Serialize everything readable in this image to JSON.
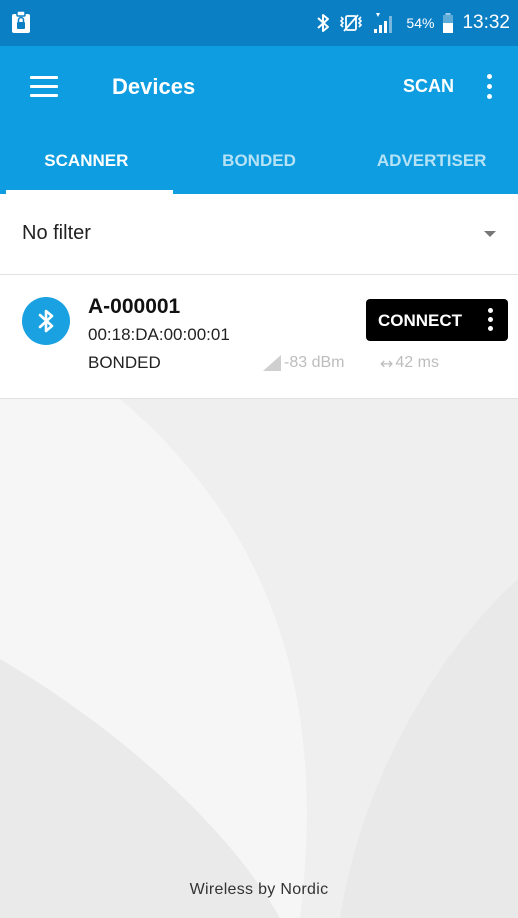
{
  "status_bar": {
    "notification_icon": "clipboard-lock-icon",
    "bluetooth_icon": "bluetooth-icon",
    "mute_icon": "mute-vibrate-icon",
    "signal_icon": "signal-icon",
    "battery_percent": "54%",
    "battery_icon": "battery-icon",
    "time": "13:32"
  },
  "app_bar": {
    "title": "Devices",
    "scan_label": "SCAN",
    "menu_icon": "hamburger-menu-icon",
    "overflow_icon": "more-vertical-icon"
  },
  "tabs": [
    {
      "label": "SCANNER",
      "active": true
    },
    {
      "label": "BONDED",
      "active": false
    },
    {
      "label": "ADVERTISER",
      "active": false
    }
  ],
  "filter": {
    "label": "No filter",
    "dropdown_icon": "caret-down-icon"
  },
  "devices": [
    {
      "name": "A-000001",
      "address": "00:18:DA:00:00:01",
      "bond_state": "BONDED",
      "rssi": "-83 dBm",
      "interval": "42 ms",
      "connect_label": "CONNECT",
      "icon": "bluetooth-icon"
    }
  ],
  "footer": {
    "text": "Wireless by Nordic"
  },
  "colors": {
    "status_bar": "#0a7fc4",
    "primary": "#0d9de0",
    "connect_button": "#000000",
    "muted_text": "#bdbdbd"
  }
}
